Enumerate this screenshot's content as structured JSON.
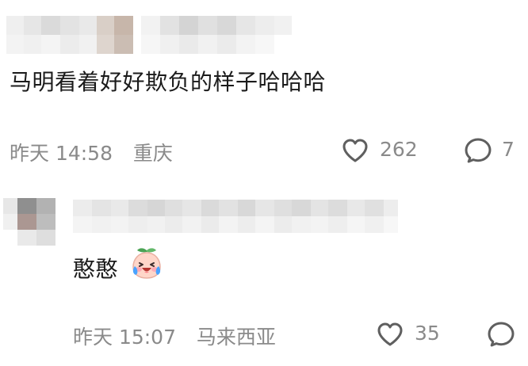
{
  "comments": [
    {
      "text": "马明看着好好欺负的样子哈哈哈",
      "time": "昨天 14:58",
      "location": "重庆",
      "like_count": "262",
      "reply_count": "7",
      "reply_icon": "chat-bubble-icon",
      "like_icon": "heart-icon"
    }
  ],
  "replies": [
    {
      "text": "憨憨",
      "emoji": "crying-laughing-peach-emoji",
      "time": "昨天 15:07",
      "location": "马来西亚",
      "like_count": "35",
      "reply_icon": "chat-bubble-icon",
      "like_icon": "heart-icon"
    }
  ],
  "colors": {
    "text": "#1b1b1b",
    "meta": "#8a8a8a",
    "icon_stroke": "#5f5f5f",
    "background": "#ffffff"
  }
}
